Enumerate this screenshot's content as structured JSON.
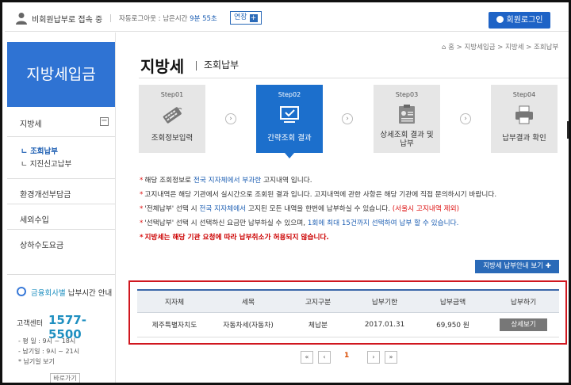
{
  "topbar": {
    "user_status": "비회원납부로 접속 중",
    "auto_logout_prefix": "자동로그아웃 : 남은시간",
    "auto_logout_time": "9분 55초",
    "extend_label": "연장",
    "login_label": "회원로그인"
  },
  "sidebar": {
    "title": "지방세입금",
    "section": "지방세",
    "sub_items": [
      "조회납부",
      "지진신고납부"
    ],
    "menus": [
      "환경개선부담금",
      "세외수입",
      "상하수도요금"
    ],
    "bank_hours_highlight": "금융회사별",
    "bank_hours_rest": "납부시간 안내",
    "call_center_label": "고객센터",
    "call_center_phone": "1577-5500",
    "hours": [
      "- 평  일 : 9시 ~ 18시",
      "- 납기일 : 9시 ~ 21시",
      "* 납기일 보기"
    ],
    "more_label": "바로가기"
  },
  "breadcrumb": "⌂ 홈 > 지방세입금 > 지방세 > 조회납부",
  "page": {
    "title": "지방세",
    "subtitle": "조회납부"
  },
  "steps": [
    {
      "num": "Step01",
      "label": "조회정보입력",
      "icon": "keyboard-icon"
    },
    {
      "num": "Step02",
      "label": "간략조회 결과",
      "icon": "monitor-check-icon"
    },
    {
      "num": "Step03",
      "label": "상세조회 결과 및\n납부",
      "icon": "id-card-icon"
    },
    {
      "num": "Step04",
      "label": "납부결과 확인",
      "icon": "printer-icon"
    }
  ],
  "notes": {
    "n1a": "해당 조회정보로 ",
    "n1b": "전국 지자체에서 부과한",
    "n1c": " 고지내역 입니다.",
    "n2": "고지내역은 해당 기관에서 실시간으로 조회된 결과 입니다. 고지내역에 관한 사항은 해당 기관에 직접 문의하시기 바랍니다.",
    "n3a": "'전체납부' 선택 시 ",
    "n3b": "전국 지자체에서",
    "n3c": " 고지된 모든 내역을 한번에 납부하실 수 있습니다. ",
    "n3d": "(서울시 고지내역 제외)",
    "n4a": "'선택납부' 선택 시 선택하신 요금만 납부하실 수 있으며, ",
    "n4b": "1회에 최대 15건까지 선택하여 납부 할 수 있습니다.",
    "n5": "지방세는 해당 기관 요청에 따라 납부취소가 허용되지 않습니다."
  },
  "guide_label": "지방세 납부안내 보기",
  "table": {
    "headers": [
      "지자체",
      "세목",
      "고지구분",
      "납부기한",
      "납부금액",
      "납부하기"
    ],
    "rows": [
      {
        "region": "제주특별자치도",
        "tax": "자동차세(자동차)",
        "type": "체납분",
        "due": "2017.01.31",
        "amount": "69,950 원",
        "action": "상세보기"
      }
    ]
  },
  "pagination": {
    "current": "1"
  },
  "colors": {
    "primary": "#1c6fcc",
    "highlight_border": "#d0171f",
    "link_blue": "#1e5fb3",
    "red": "#d11111"
  }
}
